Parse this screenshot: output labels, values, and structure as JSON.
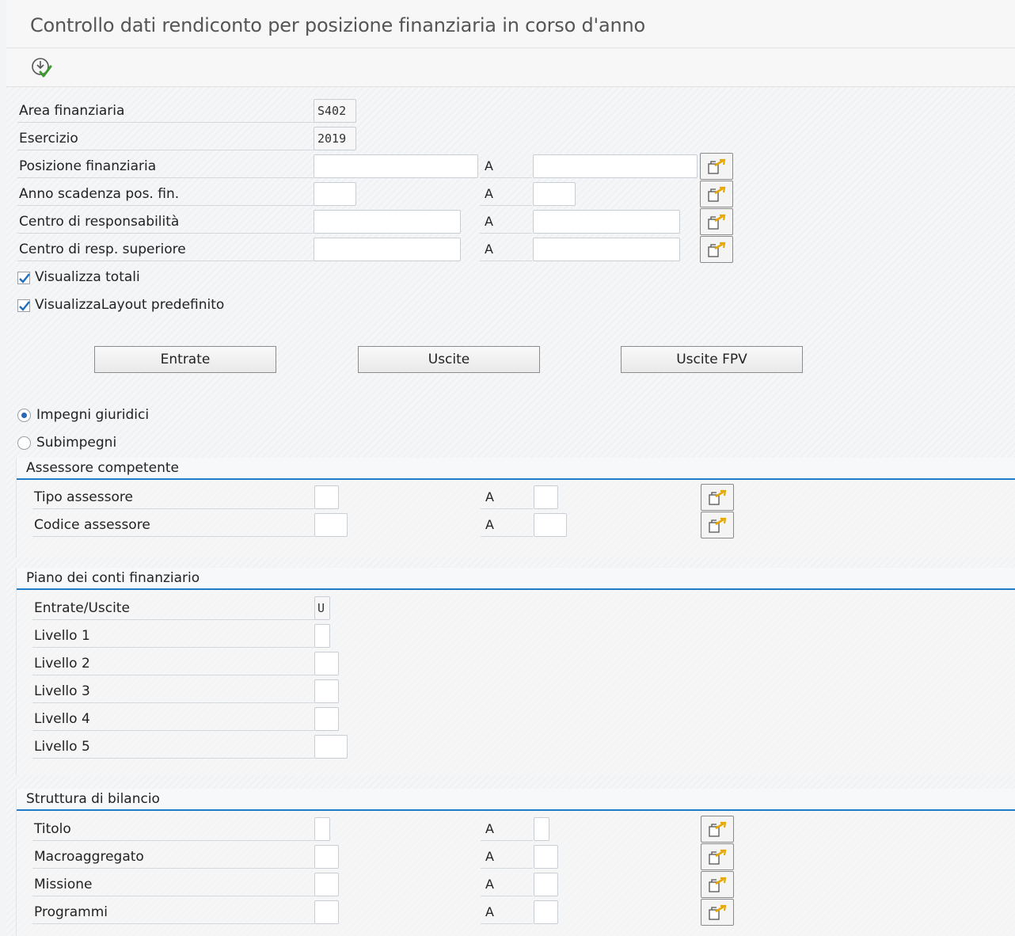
{
  "title": "Controllo dati rendiconto per posizione finanziaria in corso d'anno",
  "toolbar": {
    "execute_icon": "execute-icon"
  },
  "selection": {
    "area_label": "Area finanziaria",
    "area_value": "S402",
    "esercizio_label": "Esercizio",
    "esercizio_value": "2019",
    "posizione_label": "Posizione finanziaria",
    "anno_label": "Anno scadenza pos. fin.",
    "centro_label": "Centro di responsabilità",
    "centro_sup_label": "Centro di resp. superiore",
    "to_label": "A"
  },
  "checkboxes": {
    "totali_label": "Visualizza totali",
    "totali_checked": true,
    "layout_label": "VisualizzaLayout predefinito",
    "layout_checked": true
  },
  "buttons": {
    "entrate": "Entrate",
    "uscite": "Uscite",
    "uscite_fpv": "Uscite FPV"
  },
  "radios": {
    "impegni_label": "Impegni giuridici",
    "impegni_selected": true,
    "subimpegni_label": "Subimpegni",
    "subimpegni_selected": false
  },
  "assessore": {
    "title": "Assessore competente",
    "tipo_label": "Tipo assessore",
    "codice_label": "Codice assessore"
  },
  "piano": {
    "title": "Piano dei conti finanziario",
    "entrate_uscite_label": "Entrate/Uscite",
    "entrate_uscite_value": "U",
    "livello1": "Livello 1",
    "livello2": "Livello 2",
    "livello3": "Livello 3",
    "livello4": "Livello 4",
    "livello5": "Livello 5"
  },
  "struttura": {
    "title": "Struttura di bilancio",
    "titolo_label": "Titolo",
    "macro_label": "Macroaggregato",
    "missione_label": "Missione",
    "programmi_label": "Programmi"
  }
}
